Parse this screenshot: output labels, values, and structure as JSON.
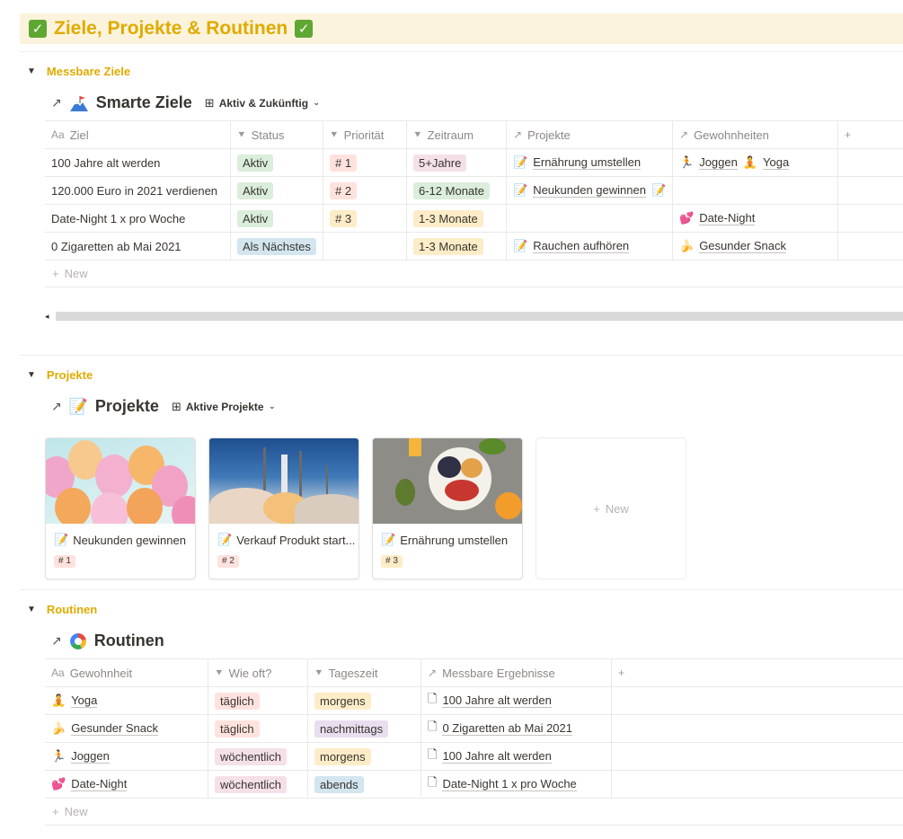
{
  "page": {
    "title": "Ziele, Projekte & Routinen"
  },
  "colors": {
    "accent": "#dfab01",
    "banner_bg": "#fbf3db",
    "check": "#5fa733"
  },
  "goals_section": {
    "label": "Messbare Ziele",
    "db_title": "Smarte Ziele",
    "db_icon": "mountain-flag-icon",
    "view": "Aktiv & Zukünftig",
    "columns": [
      "Ziel",
      "Status",
      "Priorität",
      "Zeitraum",
      "Projekte",
      "Gewohnheiten"
    ],
    "rows": [
      {
        "ziel": "100 Jahre alt werden",
        "status": "Aktiv",
        "prio": "# 1",
        "zeitraum": "5+Jahre",
        "projekte": "Ernährung umstellen",
        "gew1": "Joggen",
        "gew2": "Yoga"
      },
      {
        "ziel": "120.000 Euro in 2021 verdienen",
        "status": "Aktiv",
        "prio": "# 2",
        "zeitraum": "6-12 Monate",
        "projekte": "Neukunden gewinnen",
        "gew1": "",
        "gew2": ""
      },
      {
        "ziel": "Date-Night 1 x pro Woche",
        "status": "Aktiv",
        "prio": "# 3",
        "zeitraum": "1-3 Monate",
        "projekte": "",
        "gew1": "Date-Night",
        "gew2": ""
      },
      {
        "ziel": "0 Zigaretten ab Mai 2021",
        "status": "Als Nächstes",
        "prio": "",
        "zeitraum": "1-3 Monate",
        "projekte": "Rauchen aufhören",
        "gew1": "Gesunder Snack",
        "gew2": ""
      }
    ],
    "new_label": "New"
  },
  "projects_section": {
    "label": "Projekte",
    "db_title": "Projekte",
    "view": "Aktive Projekte",
    "cards": [
      {
        "name": "Neukunden gewinnen",
        "tag": "# 1"
      },
      {
        "name": "Verkauf Produkt start...",
        "tag": "# 2"
      },
      {
        "name": "Ernährung umstellen",
        "tag": "# 3"
      }
    ],
    "new_label": "New"
  },
  "routines_section": {
    "label": "Routinen",
    "db_title": "Routinen",
    "columns": [
      "Gewohnheit",
      "Wie oft?",
      "Tageszeit",
      "Messbare Ergebnisse"
    ],
    "rows": [
      {
        "name": "Yoga",
        "freq": "täglich",
        "time": "morgens",
        "result": "100 Jahre alt werden"
      },
      {
        "name": "Gesunder Snack",
        "freq": "täglich",
        "time": "nachmittags",
        "result": "0 Zigaretten ab Mai 2021"
      },
      {
        "name": "Joggen",
        "freq": "wöchentlich",
        "time": "morgens",
        "result": "100 Jahre alt werden"
      },
      {
        "name": "Date-Night",
        "freq": "wöchentlich",
        "time": "abends",
        "result": "Date-Night 1 x pro Woche"
      }
    ],
    "new_label": "New"
  }
}
